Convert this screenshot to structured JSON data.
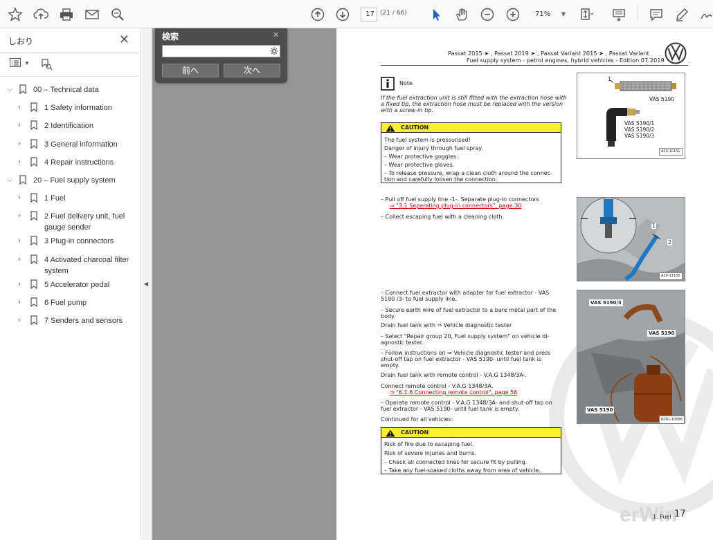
{
  "toolbar": {
    "page_current": "17",
    "page_total": "(21 / 66)",
    "zoom": "71%"
  },
  "bookmarks_panel": {
    "title": "しおり",
    "items": [
      {
        "label": "00 – Technical data",
        "level": 0,
        "expanded": true
      },
      {
        "label": "1 Safety information",
        "level": 1,
        "expanded": false
      },
      {
        "label": "2 Identification",
        "level": 1,
        "expanded": false
      },
      {
        "label": "3 General information",
        "level": 1,
        "expanded": false
      },
      {
        "label": "4 Repair instructions",
        "level": 1,
        "expanded": false
      },
      {
        "label": "20 – Fuel supply system",
        "level": 0,
        "expanded": true
      },
      {
        "label": "1 Fuel",
        "level": 1,
        "expanded": false
      },
      {
        "label": "2 Fuel delivery unit, fuel gauge sender",
        "level": 1,
        "expanded": false
      },
      {
        "label": "3 Plug-in connectors",
        "level": 1,
        "expanded": false
      },
      {
        "label": "4 Activated charcoal filter system",
        "level": 1,
        "expanded": false
      },
      {
        "label": "5 Accelerator pedal",
        "level": 1,
        "expanded": false
      },
      {
        "label": "6 Fuel pump",
        "level": 1,
        "expanded": false
      },
      {
        "label": "7 Senders and sensors",
        "level": 1,
        "expanded": false
      }
    ]
  },
  "search": {
    "title": "検索",
    "value": "",
    "prev_label": "前へ",
    "next_label": "次へ"
  },
  "document": {
    "header_models": "Passat 2015 ➤ , Passat 2019 ➤ , Passat Variant 2015 ➤ , Passat Variant",
    "header_sub": "Fuel supply system - petrol engines, hybrid vehicles - Edition 07.2019",
    "note_label": "Note",
    "note_text": [
      "If the fuel extraction unit is still fitted with the extraction hose with",
      "a fixed tip, the extraction hose must be replaced with the version",
      "with a screw-in tip."
    ],
    "caution1_title": "CAUTION",
    "caution1_lines": [
      "The fuel system is pressurised!",
      "Danger of injury through fuel spray.",
      "–   Wear protective goggles.",
      "–   Wear protective gloves.",
      "–   To release pressure, wrap a clean cloth around the connec-",
      "     tion and carefully loosen the connection."
    ],
    "step_pull_1": "–   Pull off fuel supply line -1-. Separate plug-in connectors",
    "step_pull_2": "⇒ \"3.1 Separating plug-in connectors\", page 30",
    "step_collect": "–   Collect escaping fuel with a cleaning cloth.",
    "step_connect_1": "–   Connect fuel extractor with adapter for fuel extractor - VAS",
    "step_connect_2": "     5190 /3- to fuel supply line.",
    "step_secure_1": "–   Secure earth wire of fuel extractor to a bare metal part of the",
    "step_secure_2": "     body.",
    "drain_tester": "Drain fuel tank with ⇒ Vehicle diagnostic tester",
    "step_select_1": "–   Select \"Repair group 20, Fuel supply system\" on vehicle di-",
    "step_select_2": "     agnostic tester.",
    "step_follow_1": "–   Follow instructions on ⇒ Vehicle diagnostic tester and press",
    "step_follow_2": "     shut-off tap on fuel extractor - VAS 5190- until fuel tank is",
    "step_follow_3": "     empty.",
    "drain_remote": "Drain fuel tank with remote control - V.A.G 1348/3A-.",
    "step_remote_1": "     Connect remote control - V.A.G 1348/3A.",
    "step_remote_2": "⇒ \"6.1.6 Connecting remote control\", page 56",
    "step_operate_1": "–   Operate remote control - V.A.G 1348/3A- and shut-off tap on",
    "step_operate_2": "     fuel extractor - VAS 5190- until fuel tank is empty.",
    "continued": "Continued for all vehicles:",
    "caution2_title": "CAUTION",
    "caution2_lines": [
      "Risk of fire due to escaping fuel.",
      "Risk of severe injuries and burns.",
      "–   Check all connected lines for secure fit by pulling.",
      "–   Take any fuel-soaked cloths away from area of vehicle."
    ],
    "fig1_callout": "1",
    "fig1_labels": [
      "VAS 5190",
      "VAS 5190/1",
      "VAS 5190/2",
      "VAS 5190/3"
    ],
    "fig1_code": "A20-10151",
    "fig2_callouts": [
      "1",
      "2"
    ],
    "fig2_code": "A20-11105",
    "fig3_labels": [
      "VAS 5190/3",
      "VAS 5190",
      "VAS 5190"
    ],
    "fig3_code": "N201-10086",
    "watermark": "erWin",
    "footer_section": "1. Fuel",
    "footer_page": "17"
  }
}
